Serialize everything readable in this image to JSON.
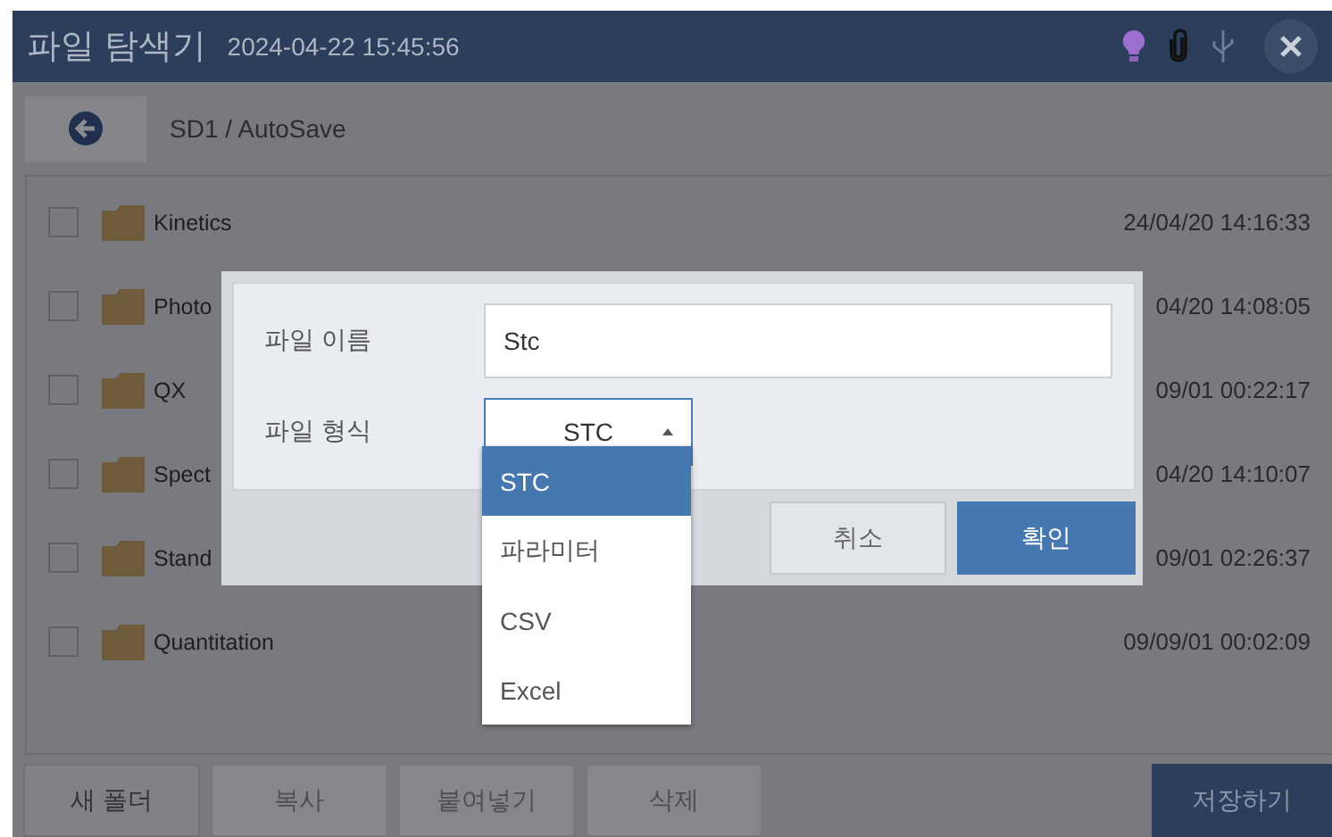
{
  "window": {
    "title": "파일 탐색기",
    "datetime": "2024-04-22 15:45:56"
  },
  "path": "SD1 / AutoSave",
  "files": [
    {
      "name": "Kinetics",
      "modified": "24/04/20 14:16:33",
      "checked": false
    },
    {
      "name": "Photo",
      "modified": "04/20 14:08:05",
      "checked": false
    },
    {
      "name": "QX",
      "modified": "09/01 00:22:17",
      "checked": false
    },
    {
      "name": "Spect",
      "modified": "04/20 14:10:07",
      "checked": false
    },
    {
      "name": "Stand",
      "modified": "09/01 02:26:37",
      "checked": false
    },
    {
      "name": "Quantitation",
      "modified": "09/09/01 00:02:09",
      "checked": false
    }
  ],
  "toolbar": [
    {
      "label": "새 폴더",
      "disabled": false
    },
    {
      "label": "복사",
      "disabled": true
    },
    {
      "label": "붙여넣기",
      "disabled": true
    },
    {
      "label": "삭제",
      "disabled": true
    }
  ],
  "save_button": {
    "label": "저장하기"
  },
  "dialog": {
    "name_label": "파일 이름",
    "name_value": "Stc",
    "format_label": "파일 형식",
    "format_value": "STC",
    "options": [
      {
        "label": "STC",
        "selected": true
      },
      {
        "label": "파라미터",
        "selected": false
      },
      {
        "label": "CSV",
        "selected": false
      },
      {
        "label": "Excel",
        "selected": false
      }
    ],
    "buttons": [
      {
        "label": "취소",
        "kind": "secondary"
      },
      {
        "label": "확인",
        "kind": "primary"
      }
    ]
  }
}
